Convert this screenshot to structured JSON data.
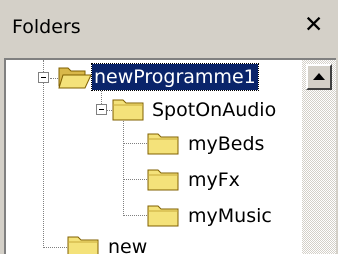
{
  "panel": {
    "title": "Folders",
    "close_glyph": "✕"
  },
  "tree": {
    "items": [
      {
        "label": "newProgramme1",
        "selected": true,
        "expanded": true,
        "icon": "folder-open-icon"
      },
      {
        "label": "SpotOnAudio",
        "expanded": true,
        "icon": "folder-icon"
      },
      {
        "label": "myBeds",
        "icon": "folder-icon"
      },
      {
        "label": "myFx",
        "icon": "folder-icon"
      },
      {
        "label": "myMusic",
        "icon": "folder-icon"
      },
      {
        "label": "new",
        "icon": "folder-icon"
      }
    ]
  },
  "scrollbar": {
    "up_icon": "arrow-up-icon"
  },
  "colors": {
    "selection": "#0a246a",
    "folder": "#f4e27a",
    "panel": "#d4d0c8"
  }
}
